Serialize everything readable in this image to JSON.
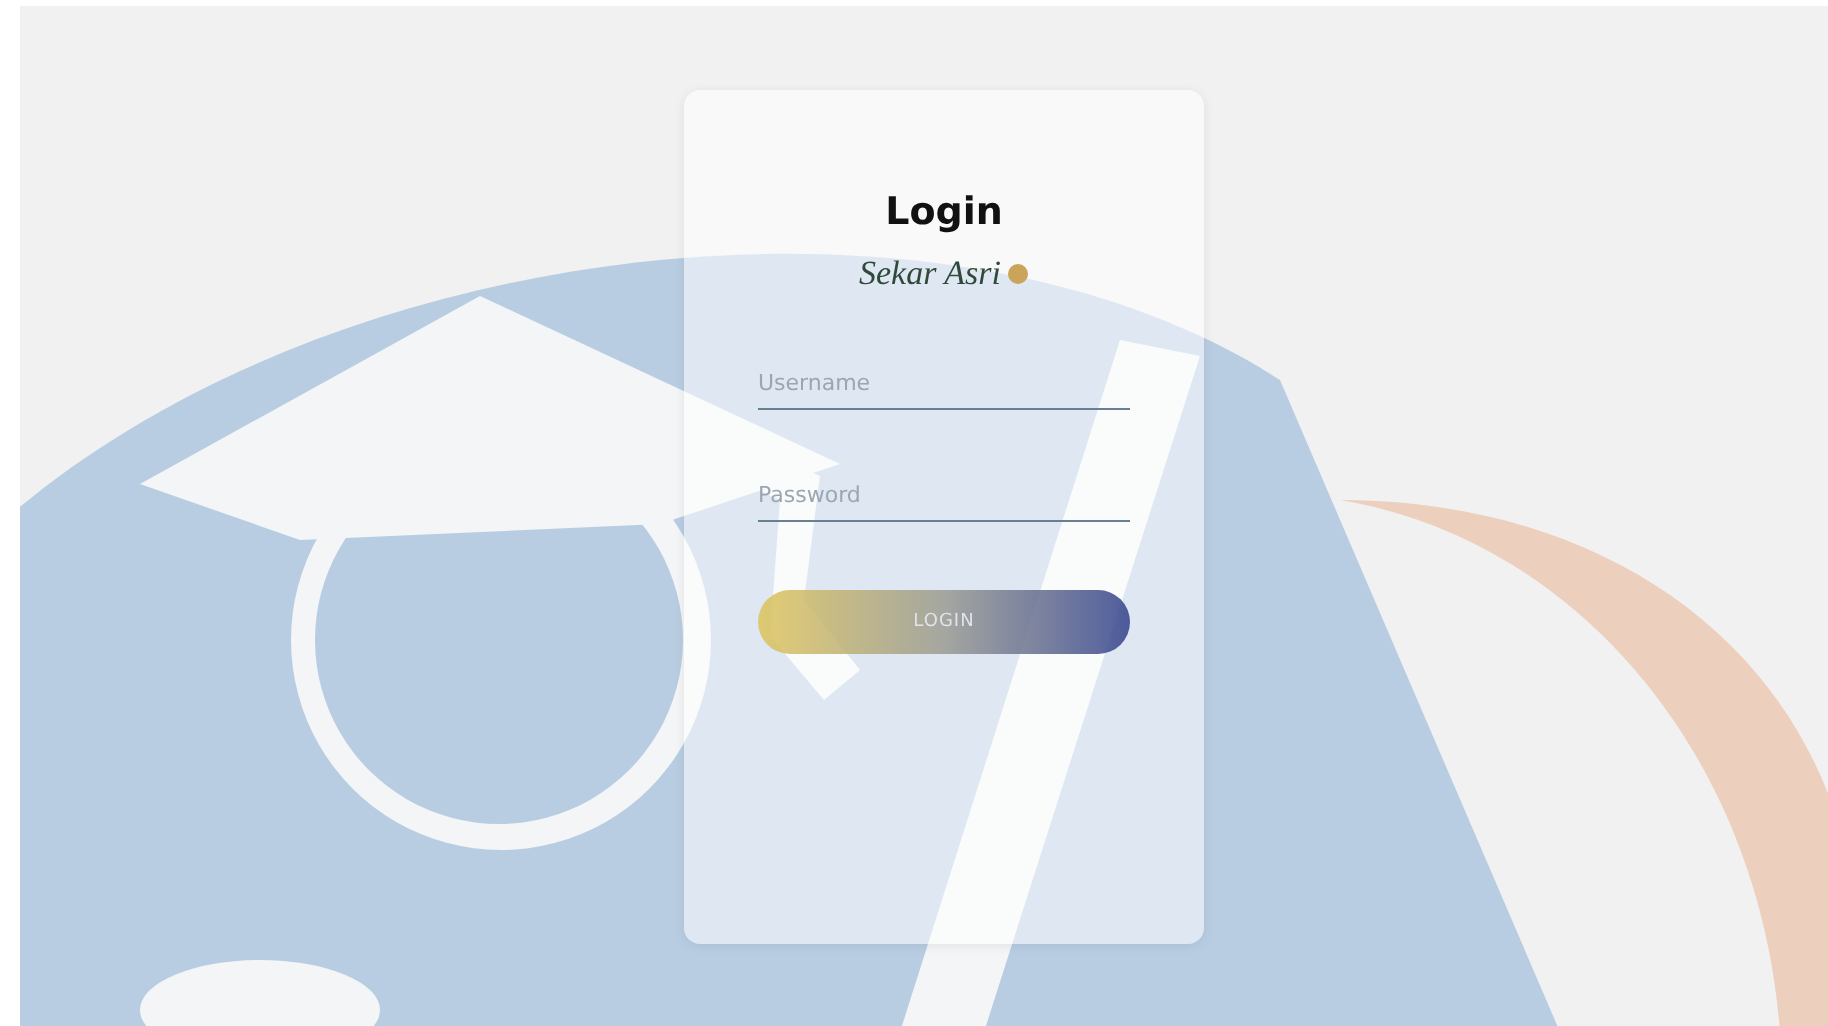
{
  "login_card": {
    "title": "Login",
    "logo_text": "Sekar Asri",
    "fields": [
      {
        "placeholder": "Username"
      },
      {
        "placeholder": "Password"
      }
    ],
    "button": "LOGIN"
  }
}
